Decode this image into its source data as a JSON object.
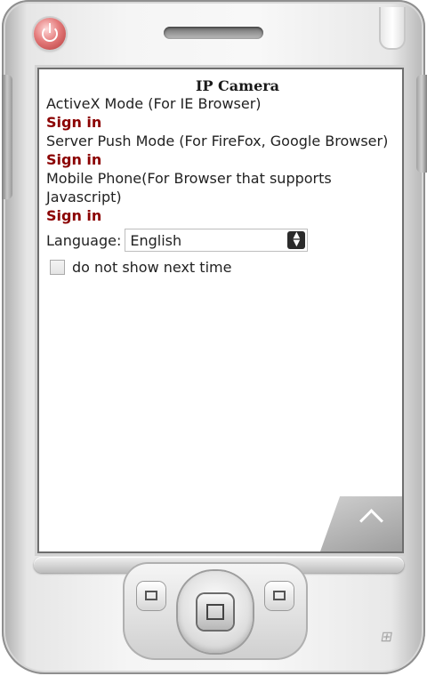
{
  "device": {
    "power_icon": "power-icon",
    "softkey_icon": "chevron-up-icon",
    "left_key_icon": "calendar-icon",
    "right_key_icon": "contacts-icon",
    "logo_icon": "windows-logo-icon",
    "accent_color": "#8b0000"
  },
  "page": {
    "title": "IP Camera",
    "modes": [
      {
        "description": "ActiveX  Mode (For IE Browser)",
        "signin_label": "Sign in"
      },
      {
        "description": "Server  Push Mode (For FireFox, Google Browser)",
        "signin_label": "Sign in"
      },
      {
        "description": "Mobile Phone(For Browser that supports Javascript)",
        "signin_label": "Sign in"
      }
    ],
    "language": {
      "label": "Language:",
      "selected": "English"
    },
    "checkbox": {
      "label": "do  not  show  next  time",
      "checked": false
    }
  }
}
